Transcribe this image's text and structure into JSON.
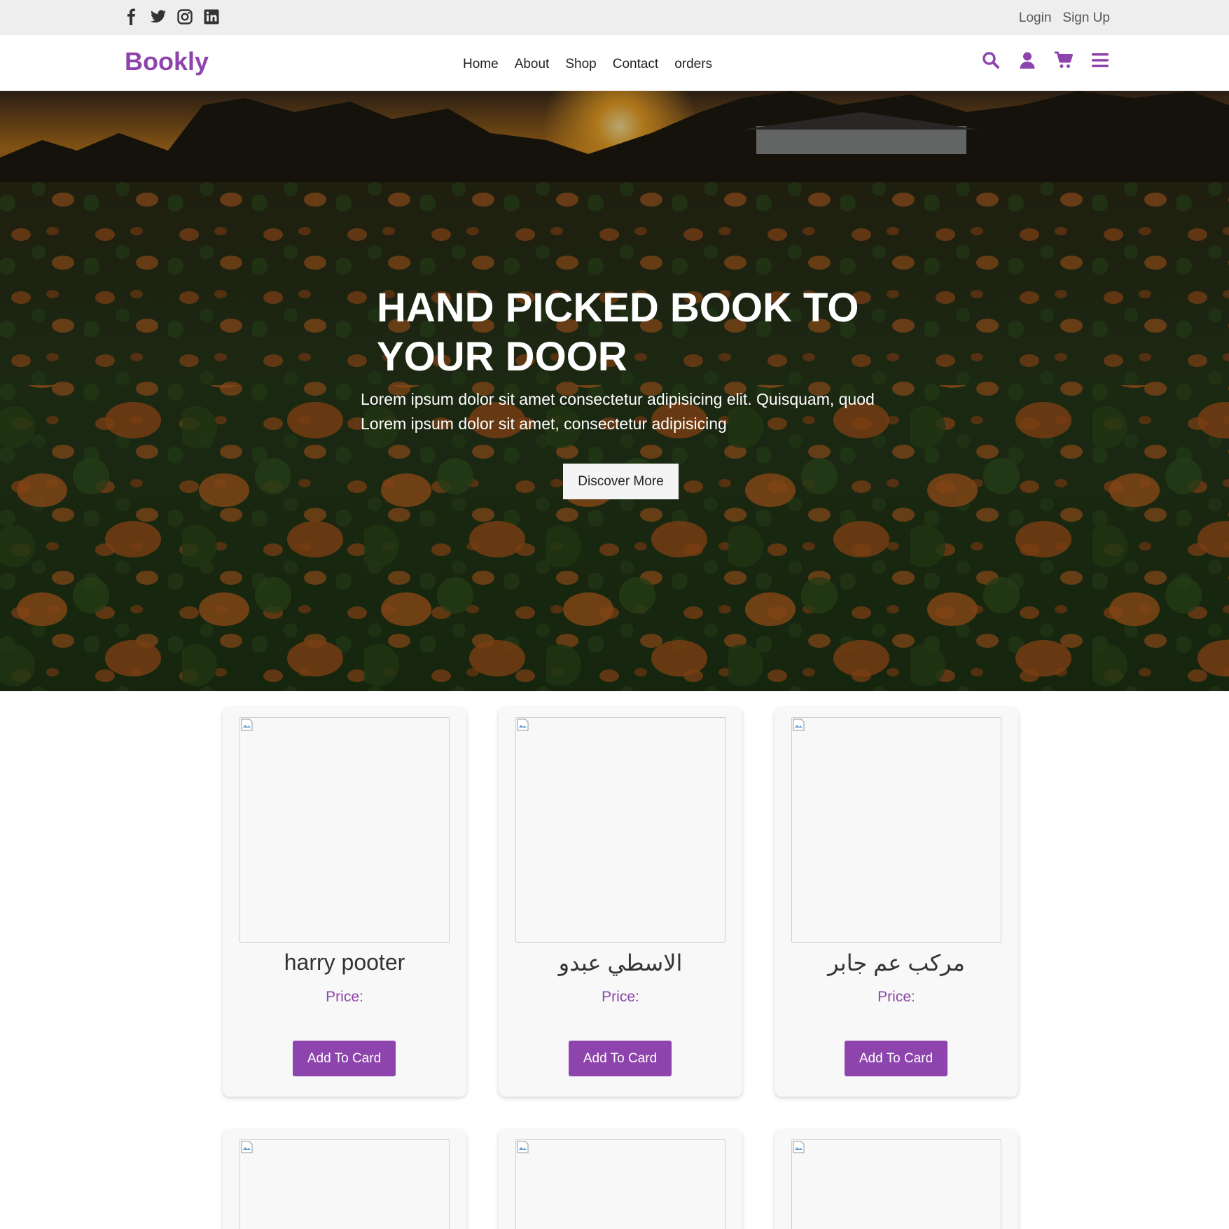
{
  "topbar": {
    "social_icons": [
      "facebook-icon",
      "twitter-icon",
      "instagram-icon",
      "linkedin-icon"
    ],
    "login": "Login",
    "signup": "Sign Up"
  },
  "navbar": {
    "logo": "Bookly",
    "links": [
      "Home",
      "About",
      "Shop",
      "Contact",
      "orders"
    ],
    "icons": [
      "search-icon",
      "user-icon",
      "cart-icon",
      "menu-icon"
    ]
  },
  "hero": {
    "title_line1": "HAND PICKED BOOK TO",
    "title_line2": "YOUR DOOR",
    "text_line1": "Lorem ipsum dolor sit amet consectetur adipisicing elit. Quisquam, quod",
    "text_line2": "Lorem ipsum dolor sit amet, consectetur adipisicing",
    "button": "Discover More",
    "background": "sunset-pumpkin-field-photo"
  },
  "products": [
    {
      "title": "harry pooter",
      "price_label": "Price:",
      "button": "Add To Card"
    },
    {
      "title": "الاسطي عبدو",
      "price_label": "Price:",
      "button": "Add To Card"
    },
    {
      "title": "مركب عم جابر",
      "price_label": "Price:",
      "button": "Add To Card"
    },
    {
      "title": "",
      "price_label": "",
      "button": ""
    },
    {
      "title": "",
      "price_label": "",
      "button": ""
    },
    {
      "title": "",
      "price_label": "",
      "button": ""
    }
  ],
  "colors": {
    "accent": "#8e44ad",
    "topbar_bg": "#eeeeee",
    "card_bg": "#f8f8f8"
  }
}
